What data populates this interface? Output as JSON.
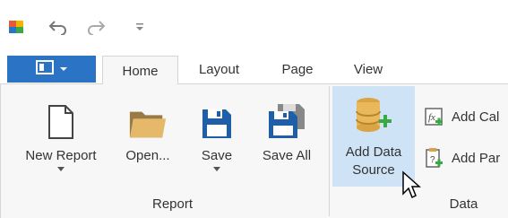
{
  "toolbar": {
    "app_icon": "app-icon",
    "undo_icon": "undo-icon",
    "redo_icon": "redo-icon",
    "customize_icon": "customize-quick-access-icon"
  },
  "file_button": {
    "icon": "file-menu-icon"
  },
  "tabs": [
    {
      "label": "Home",
      "active": true
    },
    {
      "label": "Layout",
      "active": false
    },
    {
      "label": "Page",
      "active": false
    },
    {
      "label": "View",
      "active": false
    }
  ],
  "groups": {
    "report": {
      "label": "Report",
      "buttons": [
        {
          "label": "New Report",
          "icon": "new-document-icon",
          "dropdown": true
        },
        {
          "label": "Open...",
          "icon": "folder-icon",
          "dropdown": false
        },
        {
          "label": "Save",
          "icon": "save-icon",
          "dropdown": true
        },
        {
          "label": "Save All",
          "icon": "save-all-icon",
          "dropdown": false
        }
      ]
    },
    "data": {
      "label": "Data",
      "add_data_source": {
        "label_line1": "Add Data",
        "label_line2": "Source",
        "icon": "add-database-icon"
      },
      "add_calc": {
        "label": "Add Cal",
        "icon": "calculated-field-icon"
      },
      "add_param": {
        "label": "Add Par",
        "icon": "add-parameter-icon"
      }
    }
  },
  "colors": {
    "accent": "#2a73c5",
    "hover": "#cfe3f7",
    "text": "#333333",
    "green": "#3aa845"
  }
}
